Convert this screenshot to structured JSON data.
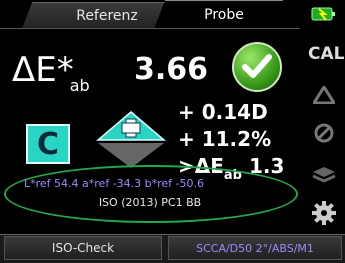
{
  "tabs": {
    "reference": "Referenz",
    "sample": "Probe"
  },
  "result": {
    "delta_label": "ΔE*",
    "delta_sub": "ab",
    "delta_value": "3.66",
    "pass_icon": "checkmark-circle-icon",
    "grade": "C"
  },
  "differences": {
    "d1": "+ 0.14D",
    "d2": "+ 11.2%",
    "d3_prefix": ">ΔE",
    "d3_sub": "ab",
    "d3_value": "1.3"
  },
  "reference_values": {
    "line": "L*ref 54.4   a*ref -34.3   b*ref -50.6",
    "standard": "ISO (2013) PC1 BB"
  },
  "side_icons": [
    "battery-plug-icon",
    "cal-icon",
    "triangle-icon",
    "no-symbol-icon",
    "stack-icon",
    "gear-icon"
  ],
  "cal_label": "CAL",
  "bottom": {
    "left_button": "ISO-Check",
    "right_button": "SCCA/D50 2°/ABS/M1"
  },
  "colors": {
    "accent_cyan": "#2ad4c4",
    "pass_green": "#3a9a1a",
    "ellipse_green": "#22a84a",
    "lab_text": "#9a8cff"
  }
}
